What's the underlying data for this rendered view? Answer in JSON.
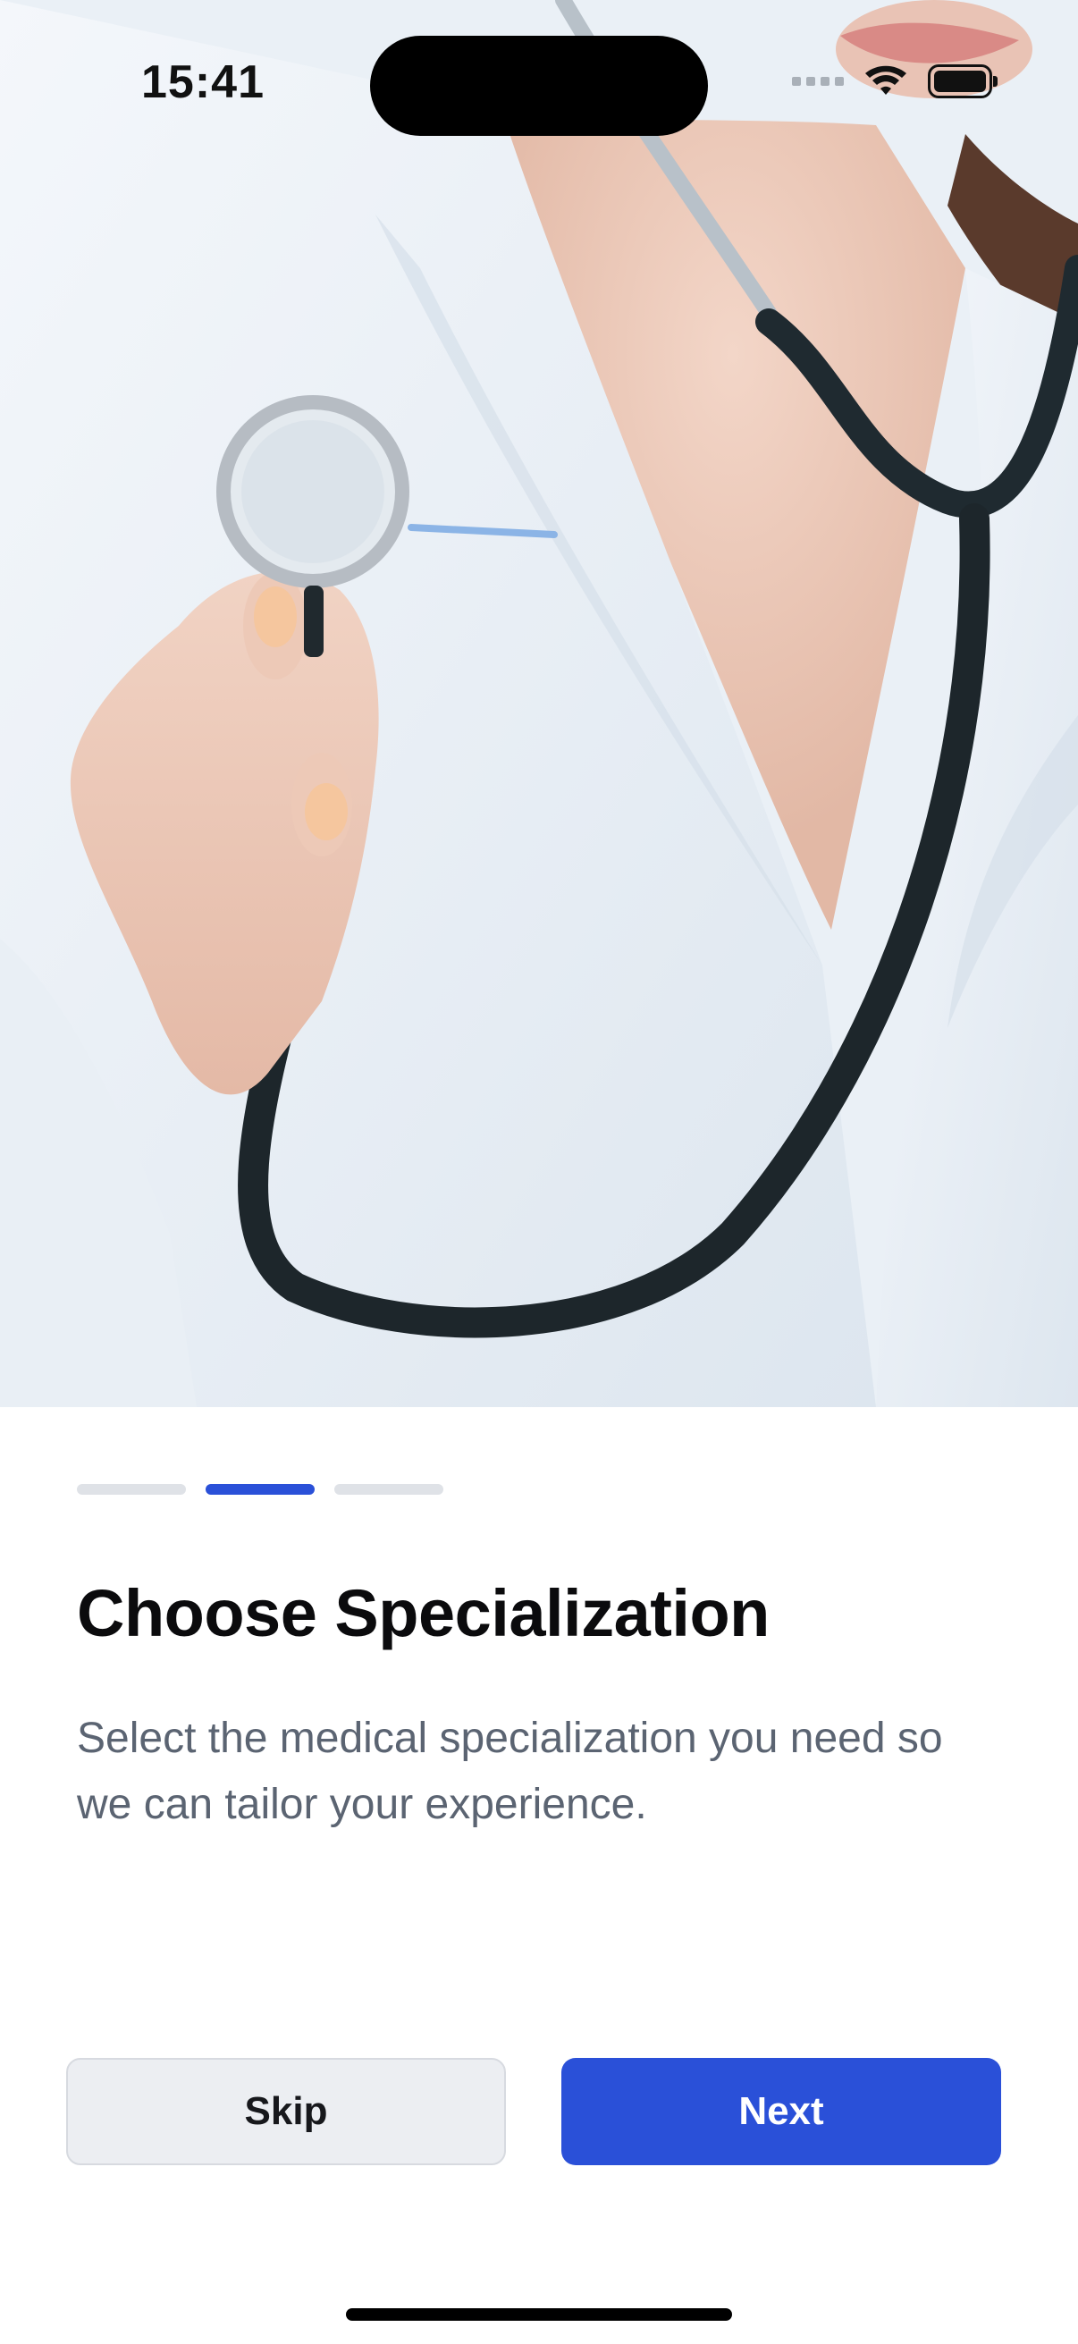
{
  "status_bar": {
    "time": "15:41"
  },
  "onboarding": {
    "current_step": 2,
    "total_steps": 3,
    "title": "Choose Specialization",
    "description": "Select the medical specialization you need so we can tailor your experience."
  },
  "actions": {
    "skip_label": "Skip",
    "next_label": "Next"
  },
  "colors": {
    "accent": "#2A50D8",
    "inactive_indicator": "#DFE2E7",
    "title_text": "#0B0B0D",
    "body_text": "#5B6472",
    "skip_background": "#ECEEF2"
  },
  "icons": {
    "signal": "cellular-signal-icon",
    "wifi": "wifi-icon",
    "battery": "battery-icon"
  }
}
